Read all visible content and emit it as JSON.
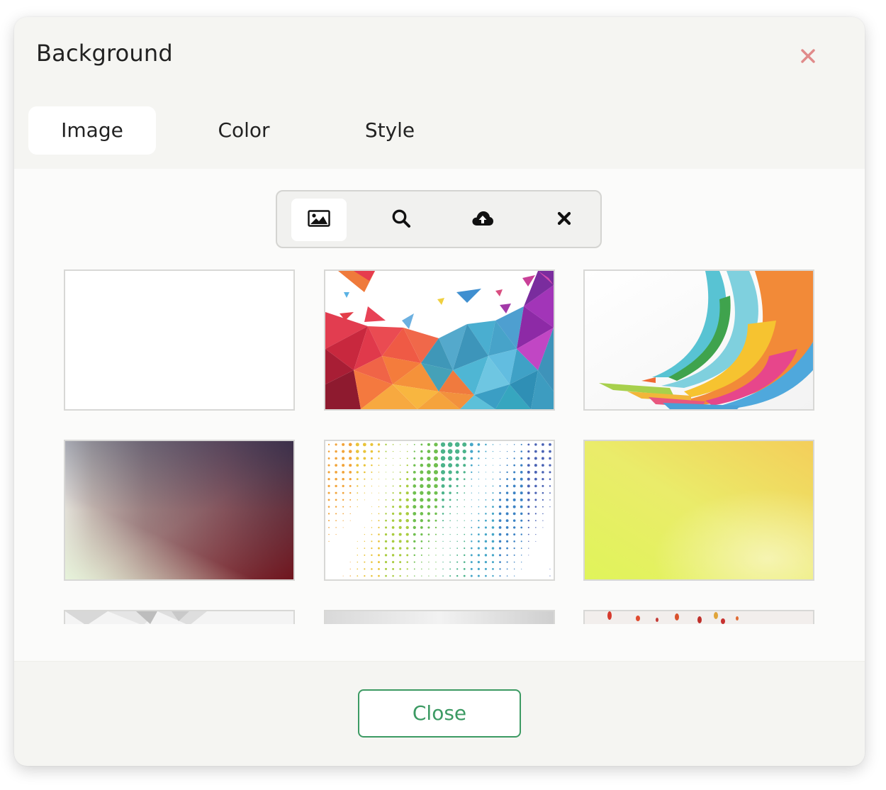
{
  "dialog": {
    "title": "Background",
    "close_icon": "close-icon",
    "accent_color": "#3c9a63"
  },
  "tabs": [
    {
      "label": "Image",
      "active": true
    },
    {
      "label": "Color",
      "active": false
    },
    {
      "label": "Style",
      "active": false
    }
  ],
  "toolbar": {
    "tools": [
      {
        "icon": "image-icon",
        "active": true
      },
      {
        "icon": "search-icon",
        "active": false
      },
      {
        "icon": "cloud-upload-icon",
        "active": false
      },
      {
        "icon": "remove-icon",
        "active": false
      }
    ]
  },
  "gallery": {
    "thumbnails": [
      {
        "style": "blank-white"
      },
      {
        "style": "colorful-low-poly-triangles"
      },
      {
        "style": "rainbow-swoosh-arcs"
      },
      {
        "style": "cream-to-maroon-navy-gradient"
      },
      {
        "style": "rainbow-halftone-dots"
      },
      {
        "style": "yellow-lime-gradient"
      },
      {
        "style": "silver-geometric"
      },
      {
        "style": "silver-gradient"
      },
      {
        "style": "red-confetti"
      }
    ]
  },
  "footer": {
    "close_label": "Close"
  }
}
